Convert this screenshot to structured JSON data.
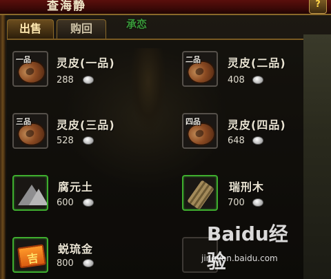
{
  "window": {
    "title": "查海静",
    "help_label": "?"
  },
  "tabs": [
    {
      "label": "出售",
      "active": true
    },
    {
      "label": "购回",
      "active": false
    }
  ],
  "background_label": "承恋",
  "items": [
    {
      "grade": "一品",
      "name": "灵皮(一品)",
      "price": "288",
      "icon": "pelt-icon"
    },
    {
      "grade": "二品",
      "name": "灵皮(二品)",
      "price": "408",
      "icon": "pelt-icon"
    },
    {
      "grade": "三品",
      "name": "灵皮(三品)",
      "price": "528",
      "icon": "pelt-icon"
    },
    {
      "grade": "四品",
      "name": "灵皮(四品)",
      "price": "648",
      "icon": "pelt-icon"
    },
    {
      "grade": "",
      "name": "腐元土",
      "price": "600",
      "icon": "soil-icon"
    },
    {
      "grade": "",
      "name": "瑞刑木",
      "price": "700",
      "icon": "wood-icon"
    },
    {
      "grade": "",
      "name": "蜕琉金",
      "price": "800",
      "icon": "gold-box-icon"
    }
  ],
  "watermark": {
    "logo": "Baidu经验",
    "url": "jingyan.baidu.com"
  },
  "colors": {
    "border_green": "#3fae2f",
    "title_bar": "#3c0907",
    "frame_gold": "#8b6a2a"
  }
}
